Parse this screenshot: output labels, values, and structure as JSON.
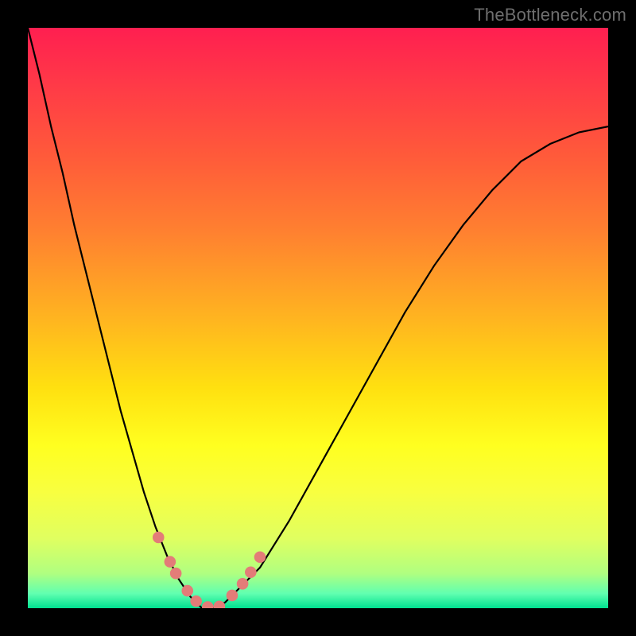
{
  "attribution": "TheBottleneck.com",
  "gradient_stops": [
    {
      "offset": 0.0,
      "color": "#ff1f50"
    },
    {
      "offset": 0.1,
      "color": "#ff3a47"
    },
    {
      "offset": 0.22,
      "color": "#ff5a3a"
    },
    {
      "offset": 0.35,
      "color": "#ff8030"
    },
    {
      "offset": 0.5,
      "color": "#ffb420"
    },
    {
      "offset": 0.62,
      "color": "#ffe010"
    },
    {
      "offset": 0.72,
      "color": "#ffff20"
    },
    {
      "offset": 0.8,
      "color": "#f8ff40"
    },
    {
      "offset": 0.88,
      "color": "#e0ff60"
    },
    {
      "offset": 0.94,
      "color": "#b0ff80"
    },
    {
      "offset": 0.975,
      "color": "#60ffb0"
    },
    {
      "offset": 1.0,
      "color": "#00e090"
    }
  ],
  "chart_data": {
    "type": "line",
    "title": "",
    "xlabel": "",
    "ylabel": "",
    "x": [
      0.0,
      0.02,
      0.04,
      0.06,
      0.08,
      0.1,
      0.12,
      0.14,
      0.16,
      0.18,
      0.2,
      0.22,
      0.24,
      0.26,
      0.28,
      0.3,
      0.32,
      0.34,
      0.35,
      0.4,
      0.45,
      0.5,
      0.55,
      0.6,
      0.65,
      0.7,
      0.75,
      0.8,
      0.85,
      0.9,
      0.95,
      1.0
    ],
    "series": [
      {
        "name": "curve",
        "values": [
          1.0,
          0.92,
          0.83,
          0.75,
          0.66,
          0.58,
          0.5,
          0.42,
          0.34,
          0.27,
          0.2,
          0.14,
          0.09,
          0.05,
          0.02,
          0.0,
          0.0,
          0.01,
          0.02,
          0.07,
          0.15,
          0.24,
          0.33,
          0.42,
          0.51,
          0.59,
          0.66,
          0.72,
          0.77,
          0.8,
          0.82,
          0.83
        ]
      }
    ],
    "xlim": [
      0,
      1
    ],
    "ylim": [
      0,
      1
    ],
    "markers": [
      {
        "x": 0.225,
        "y": 0.122
      },
      {
        "x": 0.245,
        "y": 0.08
      },
      {
        "x": 0.255,
        "y": 0.06
      },
      {
        "x": 0.275,
        "y": 0.03
      },
      {
        "x": 0.29,
        "y": 0.012
      },
      {
        "x": 0.31,
        "y": 0.002
      },
      {
        "x": 0.33,
        "y": 0.003
      },
      {
        "x": 0.352,
        "y": 0.022
      },
      {
        "x": 0.37,
        "y": 0.042
      },
      {
        "x": 0.384,
        "y": 0.062
      },
      {
        "x": 0.4,
        "y": 0.088
      }
    ],
    "marker_color": "#e37c78",
    "curve_color": "#000000"
  }
}
